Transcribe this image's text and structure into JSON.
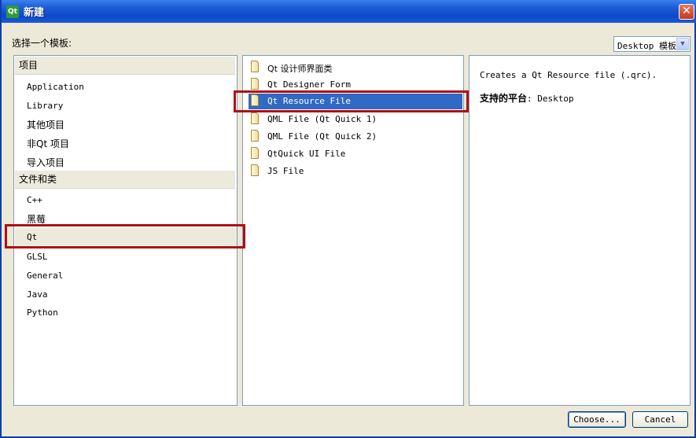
{
  "window": {
    "title": "新建",
    "app_icon_text": "Qt"
  },
  "choose_template_label": "选择一个模板:",
  "template_filter": {
    "selected": "Desktop 模板"
  },
  "categories": {
    "groups": [
      {
        "header": "项目",
        "items": [
          "Application",
          "Library",
          "其他项目",
          "非Qt 项目",
          "导入项目"
        ]
      },
      {
        "header": "文件和类",
        "items": [
          "C++",
          "黑莓",
          "Qt",
          "GLSL",
          "General",
          "Java",
          "Python"
        ]
      }
    ],
    "selected": "Qt"
  },
  "templates": {
    "items": [
      "Qt 设计师界面类",
      "Qt Designer Form",
      "Qt Resource File",
      "QML File (Qt Quick 1)",
      "QML File (Qt Quick 2)",
      "QtQuick UI File",
      "JS File"
    ],
    "selected": "Qt Resource File"
  },
  "details": {
    "description": "Creates a Qt Resource file (.qrc).",
    "platform_label": "支持的平台",
    "platform_value": ": Desktop"
  },
  "buttons": {
    "choose": "Choose...",
    "cancel": "Cancel"
  },
  "colors": {
    "selection": "#316ac5",
    "highlight_box": "#b00f12",
    "titlebar": "#0d47c9"
  }
}
